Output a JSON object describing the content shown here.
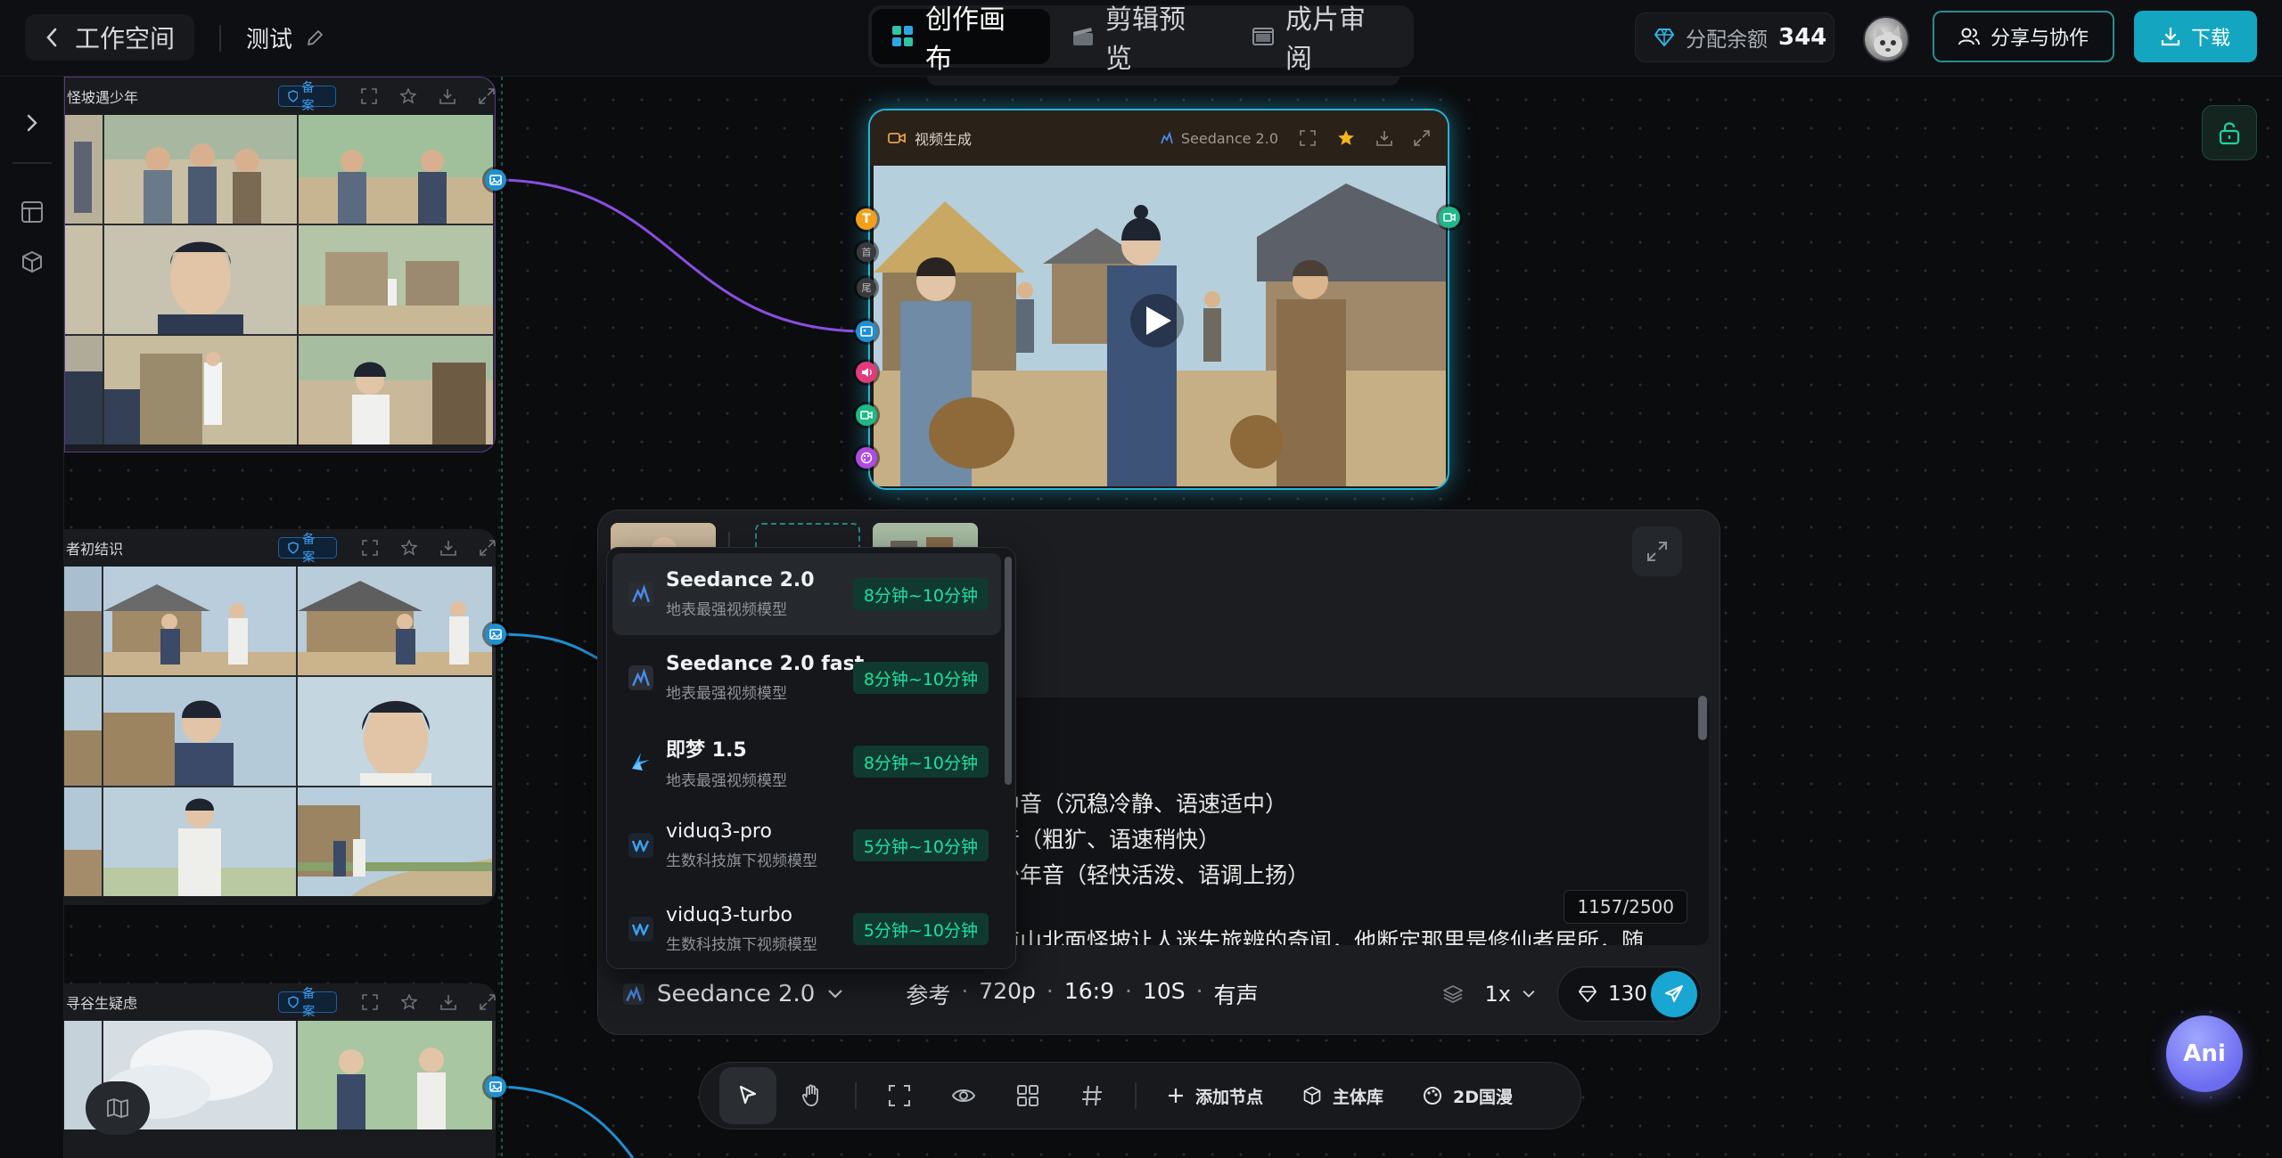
{
  "header": {
    "back_label": "工作空间",
    "project_name": "测试",
    "modes": [
      {
        "label": "创作画布",
        "icon": "grid-icon",
        "active": true
      },
      {
        "label": "剪辑预览",
        "icon": "clapper-icon",
        "active": false
      },
      {
        "label": "成片审阅",
        "icon": "film-review-icon",
        "active": false
      }
    ],
    "balance_label": "分配余额",
    "balance_value": "344",
    "share_label": "分享与协作",
    "download_label": "下载"
  },
  "storyboards": [
    {
      "title": "怪坡遇少年",
      "badge": "备案"
    },
    {
      "title": "者初结识",
      "badge": "备案"
    },
    {
      "title": "寻谷生疑虑",
      "badge": "备案"
    }
  ],
  "video_node": {
    "title": "视频生成",
    "model": "Seedance 2.0"
  },
  "prompt_panel": {
    "text_lines": [
      "。",
      "中音（沉稳冷静、语速适中）",
      "音（粗犷、语速稍快）",
      "少年音（轻快活泼、语调上扬）",
      "南山北面怪坡让人迷失旅辨的奇闻，他断定那里是修仙者居所，随"
    ],
    "char_count": "1157/2500",
    "model_selected": "Seedance 2.0",
    "params": [
      "参考",
      "720p",
      "16:9",
      "10S",
      "有声"
    ],
    "multiplier": "1x",
    "cost": "130"
  },
  "model_dropdown": {
    "items": [
      {
        "name": "Seedance 2.0",
        "desc": "地表最强视频模型",
        "time": "8分钟~10分钟",
        "selected": true,
        "icon": "seedance-icon"
      },
      {
        "name": "Seedance 2.0 fast",
        "desc": "地表最强视频模型",
        "time": "8分钟~10分钟",
        "selected": false,
        "icon": "seedance-icon"
      },
      {
        "name": "即梦 1.5",
        "desc": "地表最强视频模型",
        "time": "8分钟~10分钟",
        "selected": false,
        "icon": "jimeng-icon"
      },
      {
        "name": "viduq3-pro",
        "desc": "生数科技旗下视频模型",
        "time": "5分钟~10分钟",
        "selected": false,
        "icon": "vidu-icon"
      },
      {
        "name": "viduq3-turbo",
        "desc": "生数科技旗下视频模型",
        "time": "5分钟~10分钟",
        "selected": false,
        "icon": "vidu-icon"
      }
    ]
  },
  "toolbar": {
    "add_node": "添加节点",
    "subject_lib": "主体库",
    "style": "2D国漫"
  },
  "assistant_label": "Ani",
  "colors": {
    "accent": "#14a6c0",
    "node_border": "#25b4d8",
    "time_badge_text": "#1fe0a0",
    "connector_purple": "#8a4ee0",
    "connector_blue": "#1f8fd1"
  }
}
